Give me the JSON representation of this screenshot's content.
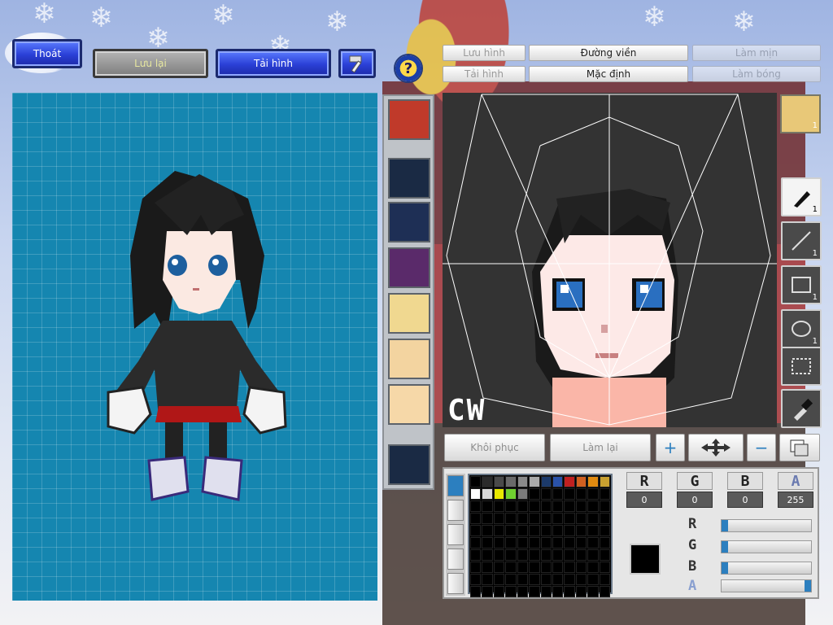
{
  "toolbar": {
    "exit_label": "Thoát",
    "save_label": "Lưu lại",
    "reload_label": "Tải hình",
    "hammer_icon": "hammer-icon",
    "help_icon": "help-icon"
  },
  "edit_menu": {
    "save_image": "Lưu hình",
    "load_image": "Tải hình",
    "outline": "Đường viền",
    "default": "Mặc định",
    "smooth": "Làm mịn",
    "shade": "Làm bóng"
  },
  "editor": {
    "corner_text": "CW"
  },
  "actions": {
    "restore": "Khôi phục",
    "redo": "Làm lại"
  },
  "tools": [
    {
      "name": "pen-tool",
      "count": "1"
    },
    {
      "name": "line-tool",
      "count": "1"
    },
    {
      "name": "rect-tool",
      "count": "1"
    },
    {
      "name": "ellipse-tool",
      "count": "1"
    },
    {
      "name": "select-tool",
      "count": ""
    },
    {
      "name": "eyedropper-tool",
      "count": ""
    }
  ],
  "face_badge": "1",
  "colors": {
    "row1": [
      "#000000",
      "#2b2b2b",
      "#4a4a4a",
      "#6a6a6a",
      "#8a8a8a",
      "#aaaaaa",
      "#1c3a6a",
      "#2a52a8",
      "#c02020",
      "#d06020",
      "#e08a10",
      "#c8a030"
    ],
    "row2": [
      "#ffffff",
      "#d8d8d8",
      "#e8e800",
      "#70d030",
      "#7a7a7a"
    ]
  },
  "channels": {
    "r_label": "R",
    "g_label": "G",
    "b_label": "B",
    "a_label": "A",
    "r_value": "0",
    "g_value": "0",
    "b_value": "0",
    "a_value": "255"
  },
  "sliders": [
    {
      "label": "R",
      "value": 0
    },
    {
      "label": "G",
      "value": 0
    },
    {
      "label": "B",
      "value": 0
    },
    {
      "label": "A",
      "value": 255
    }
  ]
}
